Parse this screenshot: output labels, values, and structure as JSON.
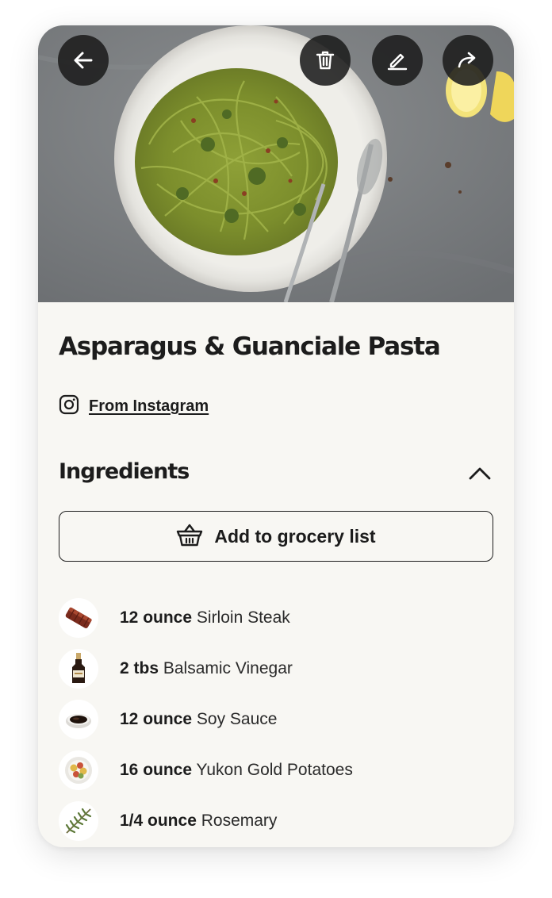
{
  "recipe": {
    "title": "Asparagus & Guanciale Pasta",
    "source_label": "From Instagram"
  },
  "toolbar": {
    "back_icon": "arrow-left-icon",
    "delete_icon": "trash-icon",
    "edit_icon": "pencil-icon",
    "share_icon": "share-arrow-icon"
  },
  "ingredients_section": {
    "title": "Ingredients",
    "collapse_icon": "chevron-up-icon",
    "grocery_button_label": "Add to grocery list",
    "grocery_button_icon": "basket-icon",
    "items": [
      {
        "qty": "12 ounce",
        "name": "Sirloin Steak",
        "icon": "steak-icon"
      },
      {
        "qty": "2 tbs",
        "name": "Balsamic Vinegar",
        "icon": "vinegar-bottle-icon"
      },
      {
        "qty": "12 ounce",
        "name": "Soy Sauce",
        "icon": "soy-sauce-bowl-icon"
      },
      {
        "qty": "16 ounce",
        "name": "Yukon Gold Potatoes",
        "icon": "potatoes-icon"
      },
      {
        "qty": "1/4 ounce",
        "name": "Rosemary",
        "icon": "rosemary-icon"
      }
    ]
  },
  "colors": {
    "card_background": "#f8f7f3",
    "text_primary": "#1c1c1c",
    "icon_button_background": "#1c1c1c",
    "photo_countertop": "#7d8083"
  }
}
